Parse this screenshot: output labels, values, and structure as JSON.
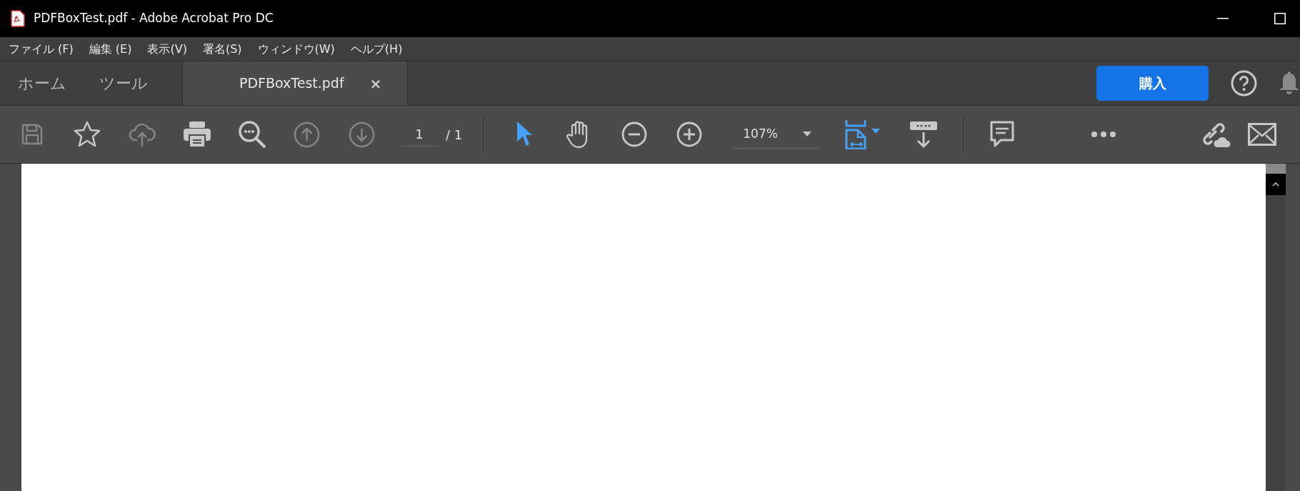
{
  "window": {
    "title": "PDFBoxTest.pdf - Adobe Acrobat Pro DC"
  },
  "menu": [
    "ファイル (F)",
    "編集 (E)",
    "表示(V)",
    "署名(S)",
    "ウィンドウ(W)",
    "ヘルプ(H)"
  ],
  "tabs": [
    {
      "label": "ホーム",
      "selected": false
    },
    {
      "label": "ツール",
      "selected": false
    }
  ],
  "document_tab": {
    "label": "PDFBoxTest.pdf",
    "selected": true,
    "close": "×"
  },
  "buy_button": "購入",
  "toolbar": {
    "buttons": [
      {
        "kind": "save",
        "disabled": true
      },
      {
        "kind": "star",
        "disabled": false
      },
      {
        "kind": "upload",
        "disabled": true
      },
      {
        "kind": "print",
        "disabled": false
      },
      {
        "kind": "find",
        "disabled": false
      },
      {
        "kind": "prev",
        "disabled": true
      },
      {
        "kind": "next",
        "disabled": true
      }
    ],
    "page_current": "1",
    "page_total": "/ 1",
    "tools": [
      {
        "kind": "select",
        "selected": true
      },
      {
        "kind": "hand",
        "selected": false
      }
    ],
    "zoom": "107%"
  }
}
